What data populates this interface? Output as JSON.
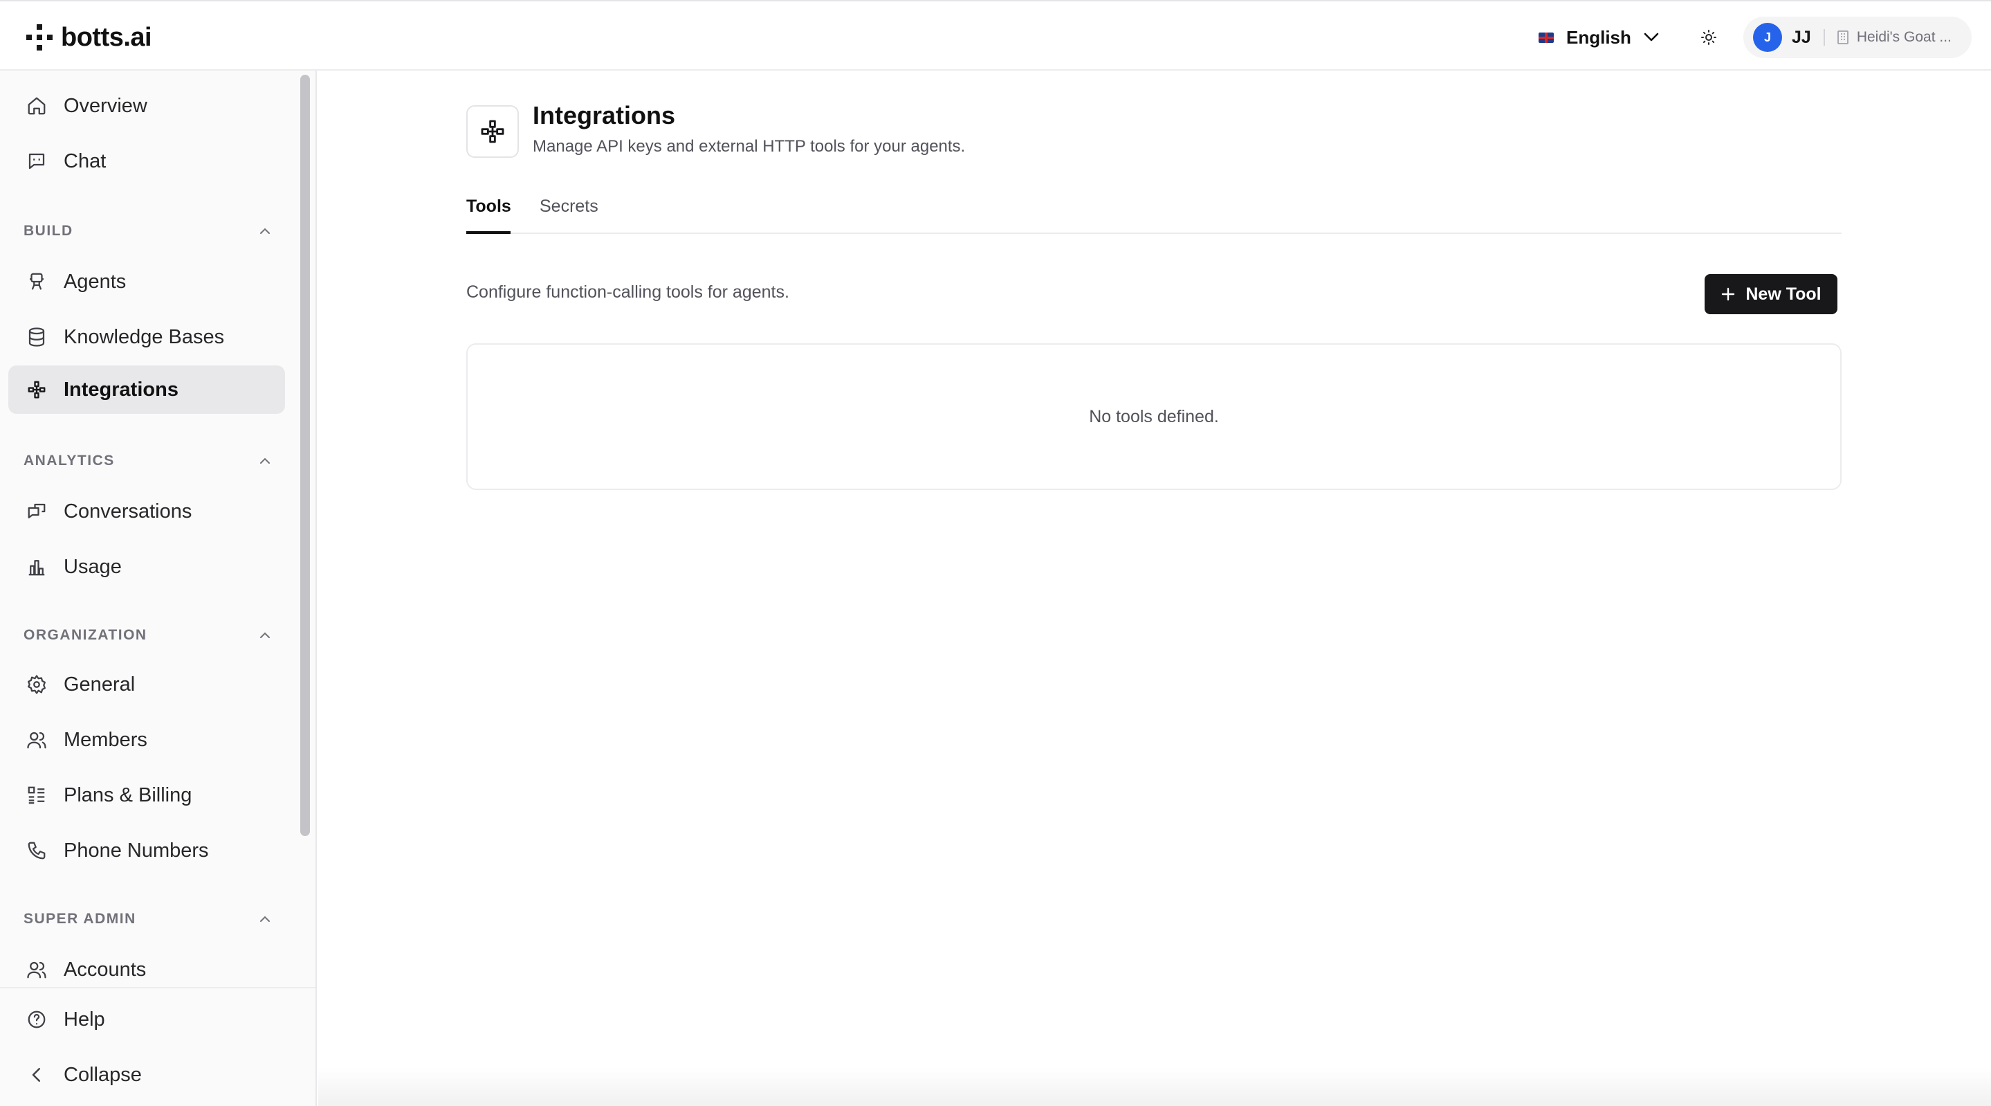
{
  "app": {
    "brand": "botts.ai"
  },
  "header": {
    "language": "English",
    "user_initial": "J",
    "user_initials": "JJ",
    "org_name": "Heidi's Goat ..."
  },
  "sidebar": {
    "items_top": [
      {
        "label": "Overview",
        "icon": "home-icon"
      },
      {
        "label": "Chat",
        "icon": "chat-icon"
      }
    ],
    "sections": {
      "build": "BUILD",
      "analytics": "ANALYTICS",
      "organization": "ORGANIZATION",
      "super_admin": "SUPER ADMIN"
    },
    "build_items": [
      {
        "label": "Agents",
        "icon": "robot-icon"
      },
      {
        "label": "Knowledge Bases",
        "icon": "database-icon"
      },
      {
        "label": "Integrations",
        "icon": "plug-icon",
        "active": true
      }
    ],
    "analytics_items": [
      {
        "label": "Conversations",
        "icon": "conversations-icon"
      },
      {
        "label": "Usage",
        "icon": "bar-chart-icon"
      }
    ],
    "organization_items": [
      {
        "label": "General",
        "icon": "gear-icon"
      },
      {
        "label": "Members",
        "icon": "users-icon"
      },
      {
        "label": "Plans & Billing",
        "icon": "list-icon"
      },
      {
        "label": "Phone Numbers",
        "icon": "phone-icon"
      }
    ],
    "super_admin_items": [
      {
        "label": "Accounts",
        "icon": "users-icon"
      }
    ],
    "footer": {
      "help": "Help",
      "collapse": "Collapse"
    }
  },
  "page": {
    "title": "Integrations",
    "subtitle": "Manage API keys and external HTTP tools for your agents.",
    "tabs": [
      {
        "label": "Tools",
        "active": true
      },
      {
        "label": "Secrets",
        "active": false
      }
    ],
    "tools_description": "Configure function-calling tools for agents.",
    "new_tool_label": "New Tool",
    "empty_state": "No tools defined."
  },
  "colors": {
    "accent_dark": "#18181b",
    "avatar_blue": "#2563eb",
    "active_nav_bg": "#e8e8ea"
  }
}
